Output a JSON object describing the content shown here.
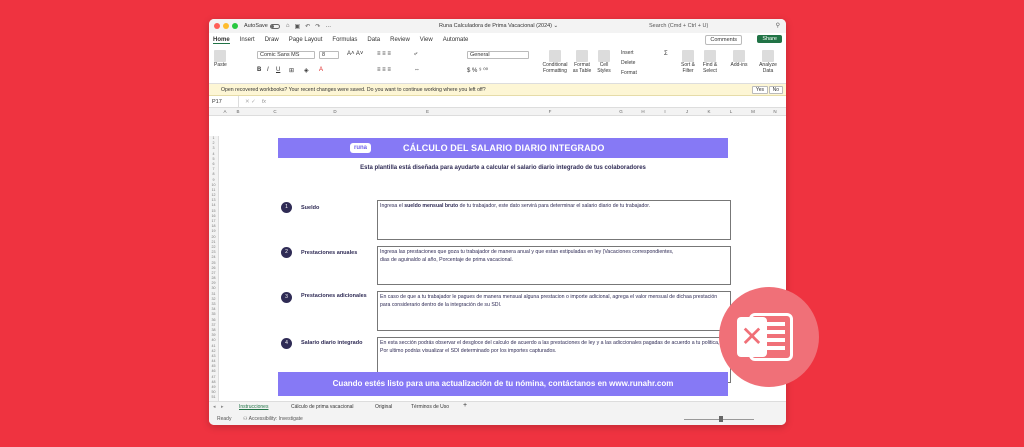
{
  "titlebar": {
    "autosave_label": "AutoSave",
    "doc_title": "Runa Calculadora de Prima Vacacional (2024) ⌄",
    "search": "Search (Cmd + Ctrl + U)"
  },
  "ribbon": {
    "tabs": [
      "Home",
      "Insert",
      "Draw",
      "Page Layout",
      "Formulas",
      "Data",
      "Review",
      "View",
      "Automate"
    ],
    "comments": "Comments",
    "share": "Share"
  },
  "toolbar": {
    "paste": "Paste",
    "font": "Comic Sans MS",
    "size": "8",
    "number_format": "General",
    "conditional": "Conditional Formatting",
    "format_table": "Format as Table",
    "cell_styles": "Cell Styles",
    "insert": "Insert",
    "delete": "Delete",
    "format": "Format",
    "sort_filter": "Sort & Filter",
    "find_select": "Find & Select",
    "addins": "Add-ins",
    "analyze": "Analyze Data"
  },
  "infobar": {
    "message": "Open recovered workbooks?  Your recent changes were saved. Do you want to continue working where you left off?",
    "yes": "Yes",
    "no": "No"
  },
  "formula_bar": {
    "cell": "P17",
    "fx": "fx"
  },
  "columns": [
    "A",
    "B",
    "C",
    "D",
    "E",
    "F",
    "G",
    "H",
    "I",
    "J",
    "K",
    "L",
    "M",
    "N",
    "O"
  ],
  "rows": [
    "1",
    "2",
    "3",
    "4",
    "5",
    "6",
    "7",
    "8",
    "9",
    "10",
    "11",
    "12",
    "13",
    "14",
    "15",
    "16",
    "17",
    "18",
    "19",
    "20",
    "21",
    "22",
    "23",
    "24",
    "25",
    "26",
    "27",
    "28",
    "29",
    "30",
    "31",
    "32",
    "33",
    "34",
    "35",
    "36",
    "37",
    "38",
    "39",
    "40",
    "41",
    "42",
    "43",
    "44",
    "45",
    "46",
    "47",
    "48",
    "49",
    "50",
    "51",
    "52"
  ],
  "sheet": {
    "logo": "runa",
    "banner_title": "CÁLCULO DEL SALARIO DIARIO INTEGRADO",
    "subtitle": "Esta plantilla está diseñada para ayudarte a calcular el salario diario integrado de tus colaboradores",
    "steps": [
      {
        "num": "1",
        "label": "Sueldo",
        "text_pre": "Ingresa el ",
        "text_bold": "sueldo mensual bruto",
        "text_post": " de tu trabajador, este dato servirá para determinar el salario diario de tu trabajador."
      },
      {
        "num": "2",
        "label": "Prestaciones anuales",
        "text": "Ingresa las prestaciones que goza tu trabajador de manera anual y que estan estipuladas en ley (Vacaciones correspondientes,\ndias de aguinaldo al año, Porcentaje de prima vacacional."
      },
      {
        "num": "3",
        "label": "Prestaciones adicionales",
        "text": "En caso de que a tu trabajador le pagues de manera mensual alguna prestacion o importe adicional, agrega el valor mensual de dichaa prestación para considerario dentro de la integración de su SDI."
      },
      {
        "num": "4",
        "label": "Salario diario integrado",
        "text": "En esta sección podrás observar el desgloce del calculo de acuerdo a las prestaciones de ley y a las adiccionales pagadas de acuerdo a tu politica, Por ultimo podrás visualizar el SDI determinado por los importes capturados."
      }
    ],
    "footer": "Cuando estés listo para una actualización de tu nómina, contáctanos en www.runahr.com"
  },
  "sheet_tabs": [
    "Instrucciones",
    "Cálculo de prima vacacional",
    "Original",
    "Términos de Uso",
    "+"
  ],
  "status": {
    "ready": "Ready",
    "accessibility": "Accessibility: Investigate"
  },
  "colors": {
    "accent": "#8679f5",
    "background": "#ef3340",
    "excel_green": "#217346",
    "navy": "#2f2b55"
  }
}
